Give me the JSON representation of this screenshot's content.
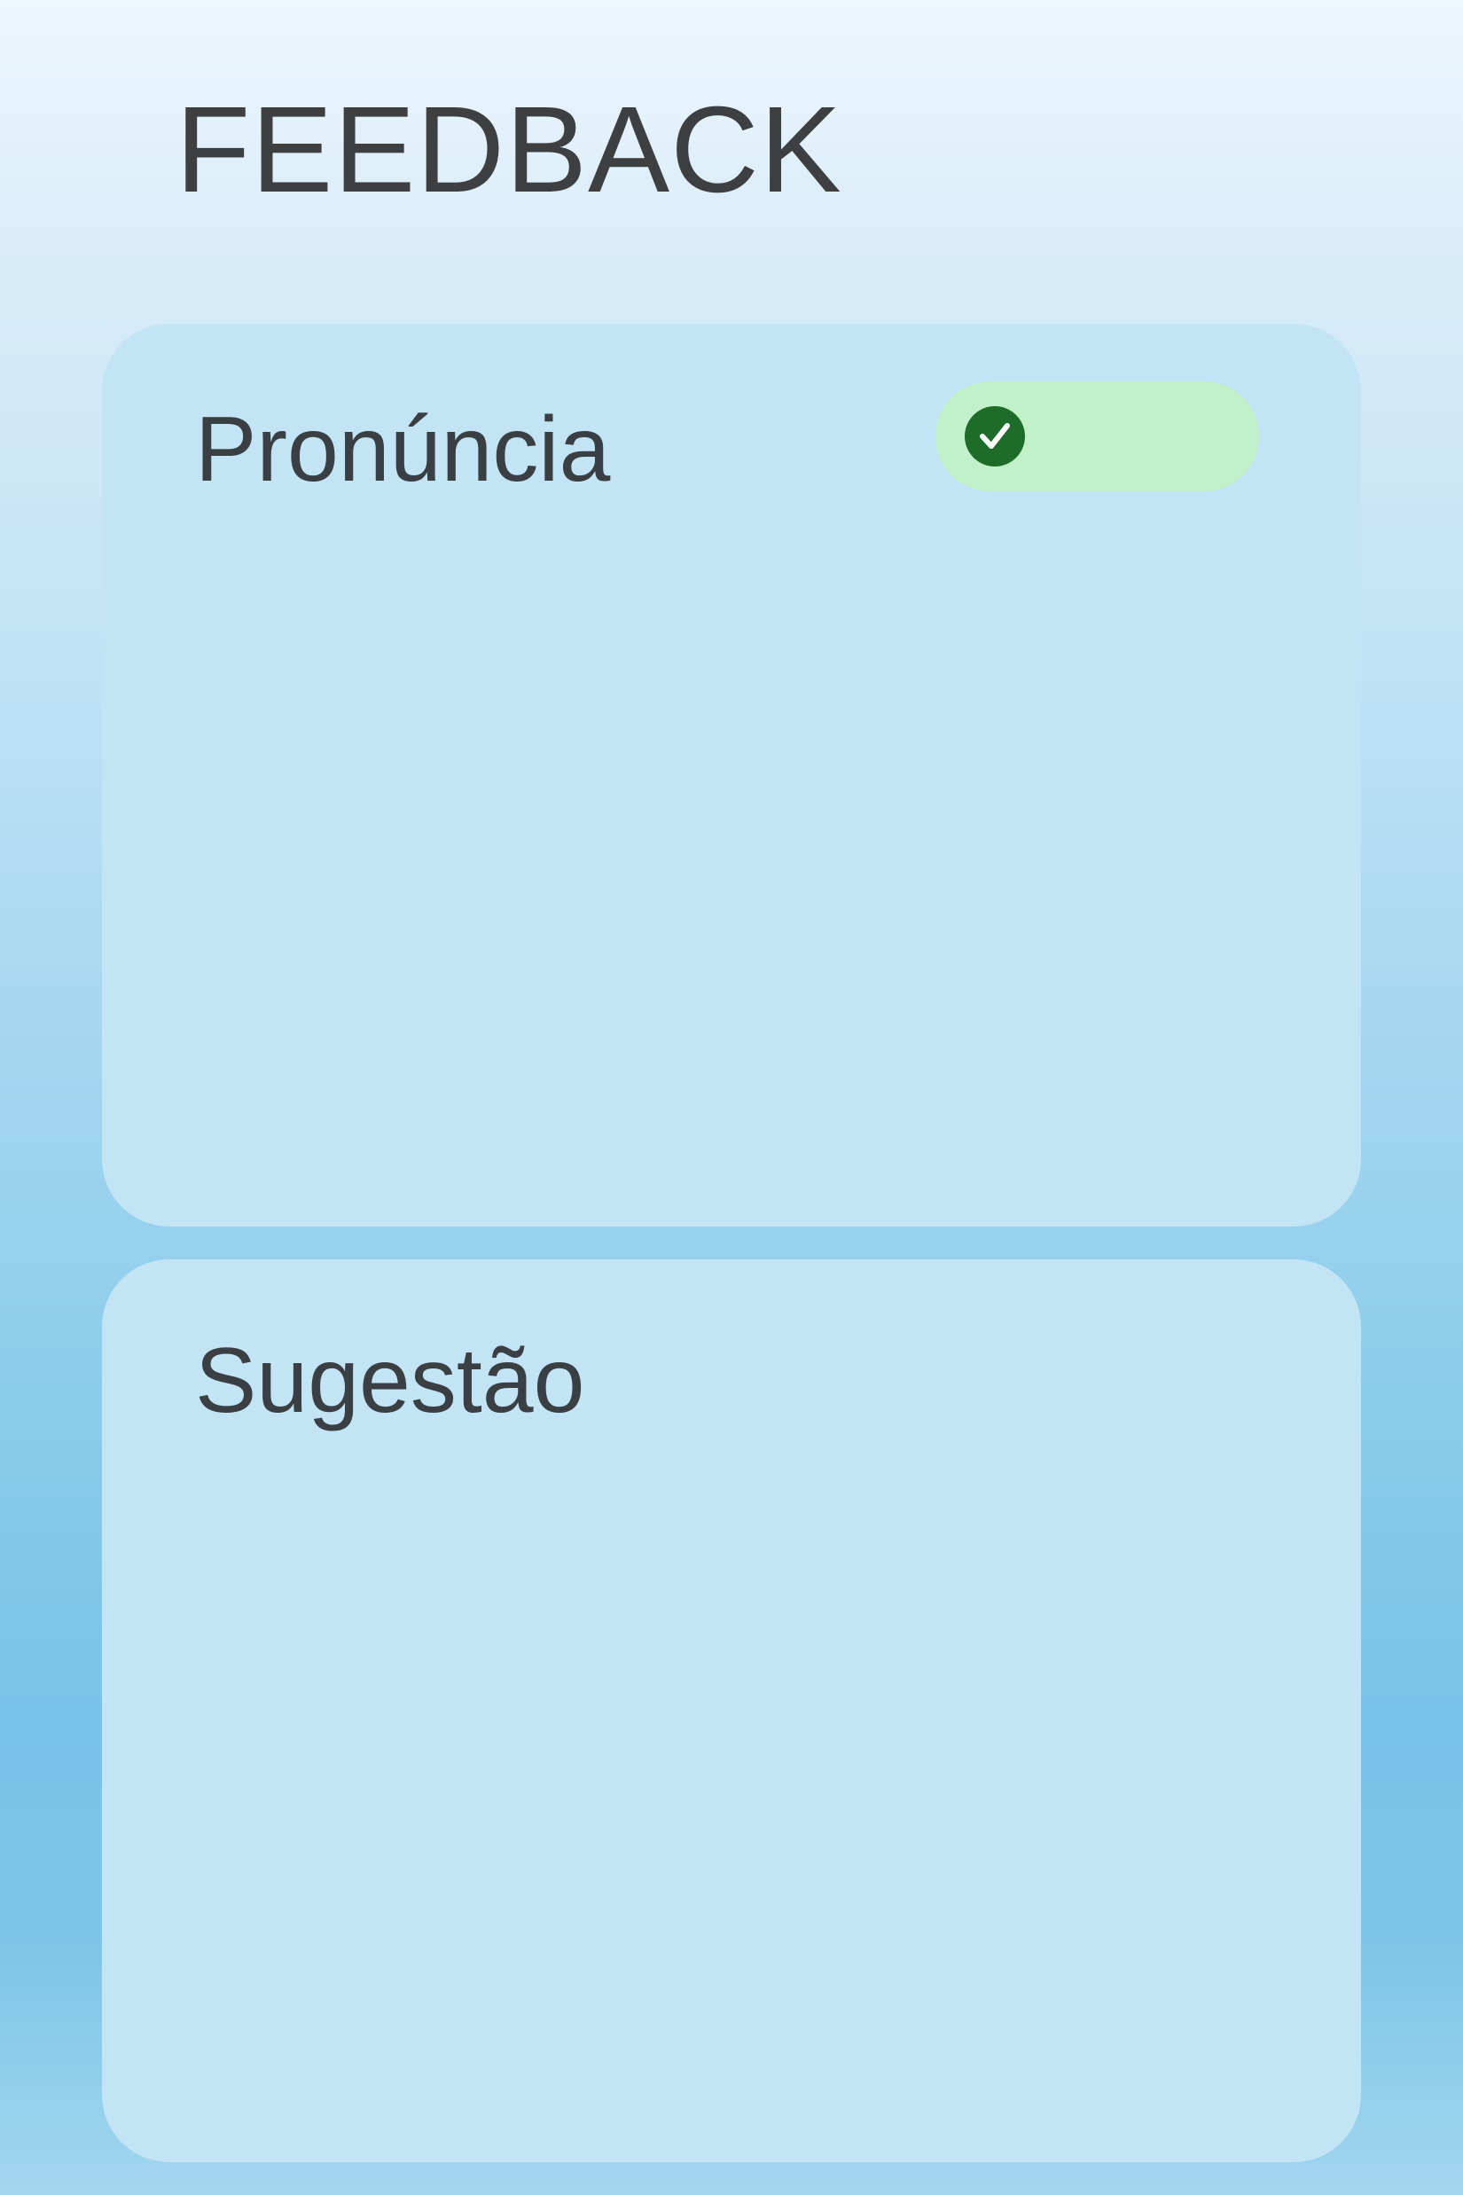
{
  "header": {
    "title": "FEEDBACK"
  },
  "cards": {
    "pronunciation": {
      "title": "Pronúncia",
      "status": {
        "icon": "check-circle-icon",
        "color_bg": "#c2f0c8",
        "color_icon": "#1e6b2a"
      }
    },
    "suggestion": {
      "title": "Sugestão"
    }
  },
  "colors": {
    "card_bg": "#c2e4f5",
    "text": "#3c4043"
  }
}
